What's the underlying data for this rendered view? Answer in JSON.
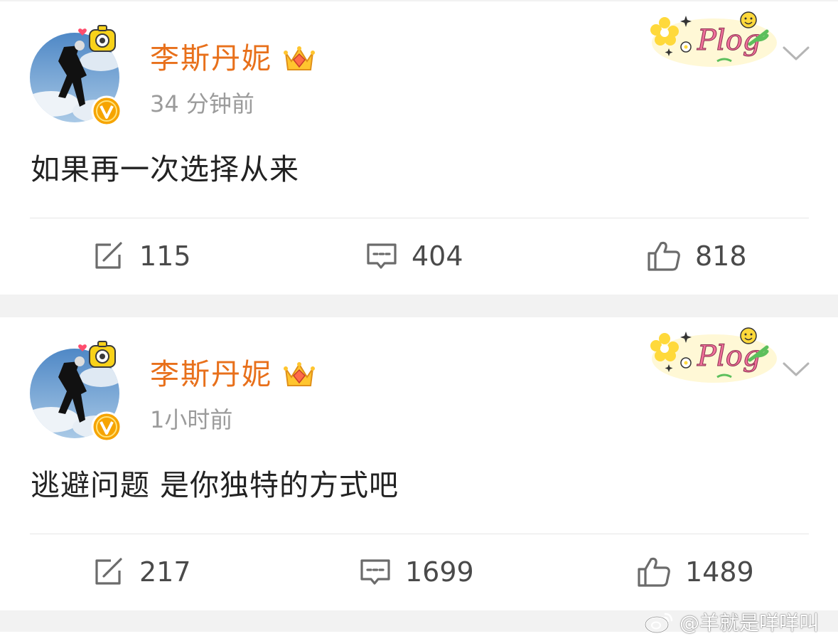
{
  "posts": [
    {
      "author": "李斯丹妮",
      "time": "34 分钟前",
      "text": "如果再一次选择从来",
      "actions": {
        "repost": "115",
        "comment": "404",
        "like": "818"
      }
    },
    {
      "author": "李斯丹妮",
      "time": "1小时前",
      "text": "逃避问题 是你独特的方式吧",
      "actions": {
        "repost": "217",
        "comment": "1699",
        "like": "1489"
      }
    }
  ],
  "sticker_text": "Plog",
  "watermark": "@羊就是咩咩叫",
  "icons": [
    "repost-icon",
    "comment-icon",
    "like-icon",
    "chevron-down-icon",
    "crown-icon",
    "verified-v-icon",
    "weibo-logo-icon"
  ],
  "colors": {
    "name": "#e8701b",
    "time": "#9b9b9b",
    "text": "#222222",
    "count": "#4a4a4a",
    "background": "#f2f2f2"
  }
}
